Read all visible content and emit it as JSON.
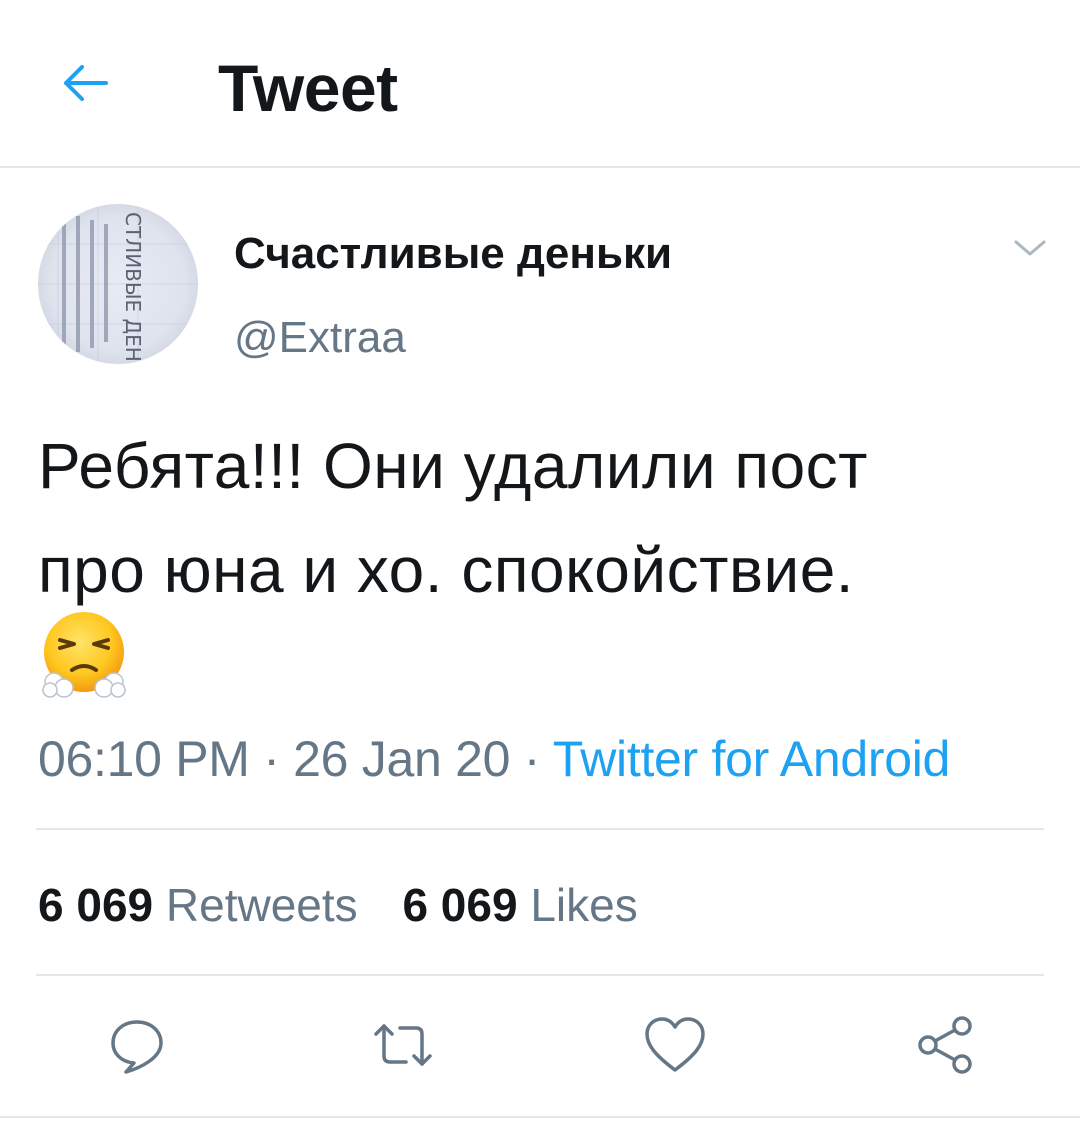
{
  "header": {
    "back_icon": "arrow-left-icon",
    "title": "Tweet"
  },
  "tweet": {
    "author": {
      "display_name": "Счастливые деньки",
      "handle": "@Extraa",
      "avatar_text": "СТЛИВЫЕ ДЕНЬ"
    },
    "text_lines": [
      "Ребята!!! Они удалили пост",
      "про юна и хо. спокойствие."
    ],
    "emoji": "face-with-steam-from-nose",
    "time": "06:10 PM",
    "date": "26 Jan 20",
    "separator": "·",
    "source": "Twitter for Android",
    "retweets": {
      "count": "6 069",
      "label": "Retweets"
    },
    "likes": {
      "count": "6 069",
      "label": "Likes"
    }
  },
  "actions": {
    "reply_icon": "reply-icon",
    "retweet_icon": "retweet-icon",
    "like_icon": "heart-icon",
    "share_icon": "share-icon"
  },
  "colors": {
    "accent": "#1da1f2",
    "text": "#14171a",
    "secondary": "#657786",
    "border": "#e1e8ed"
  }
}
